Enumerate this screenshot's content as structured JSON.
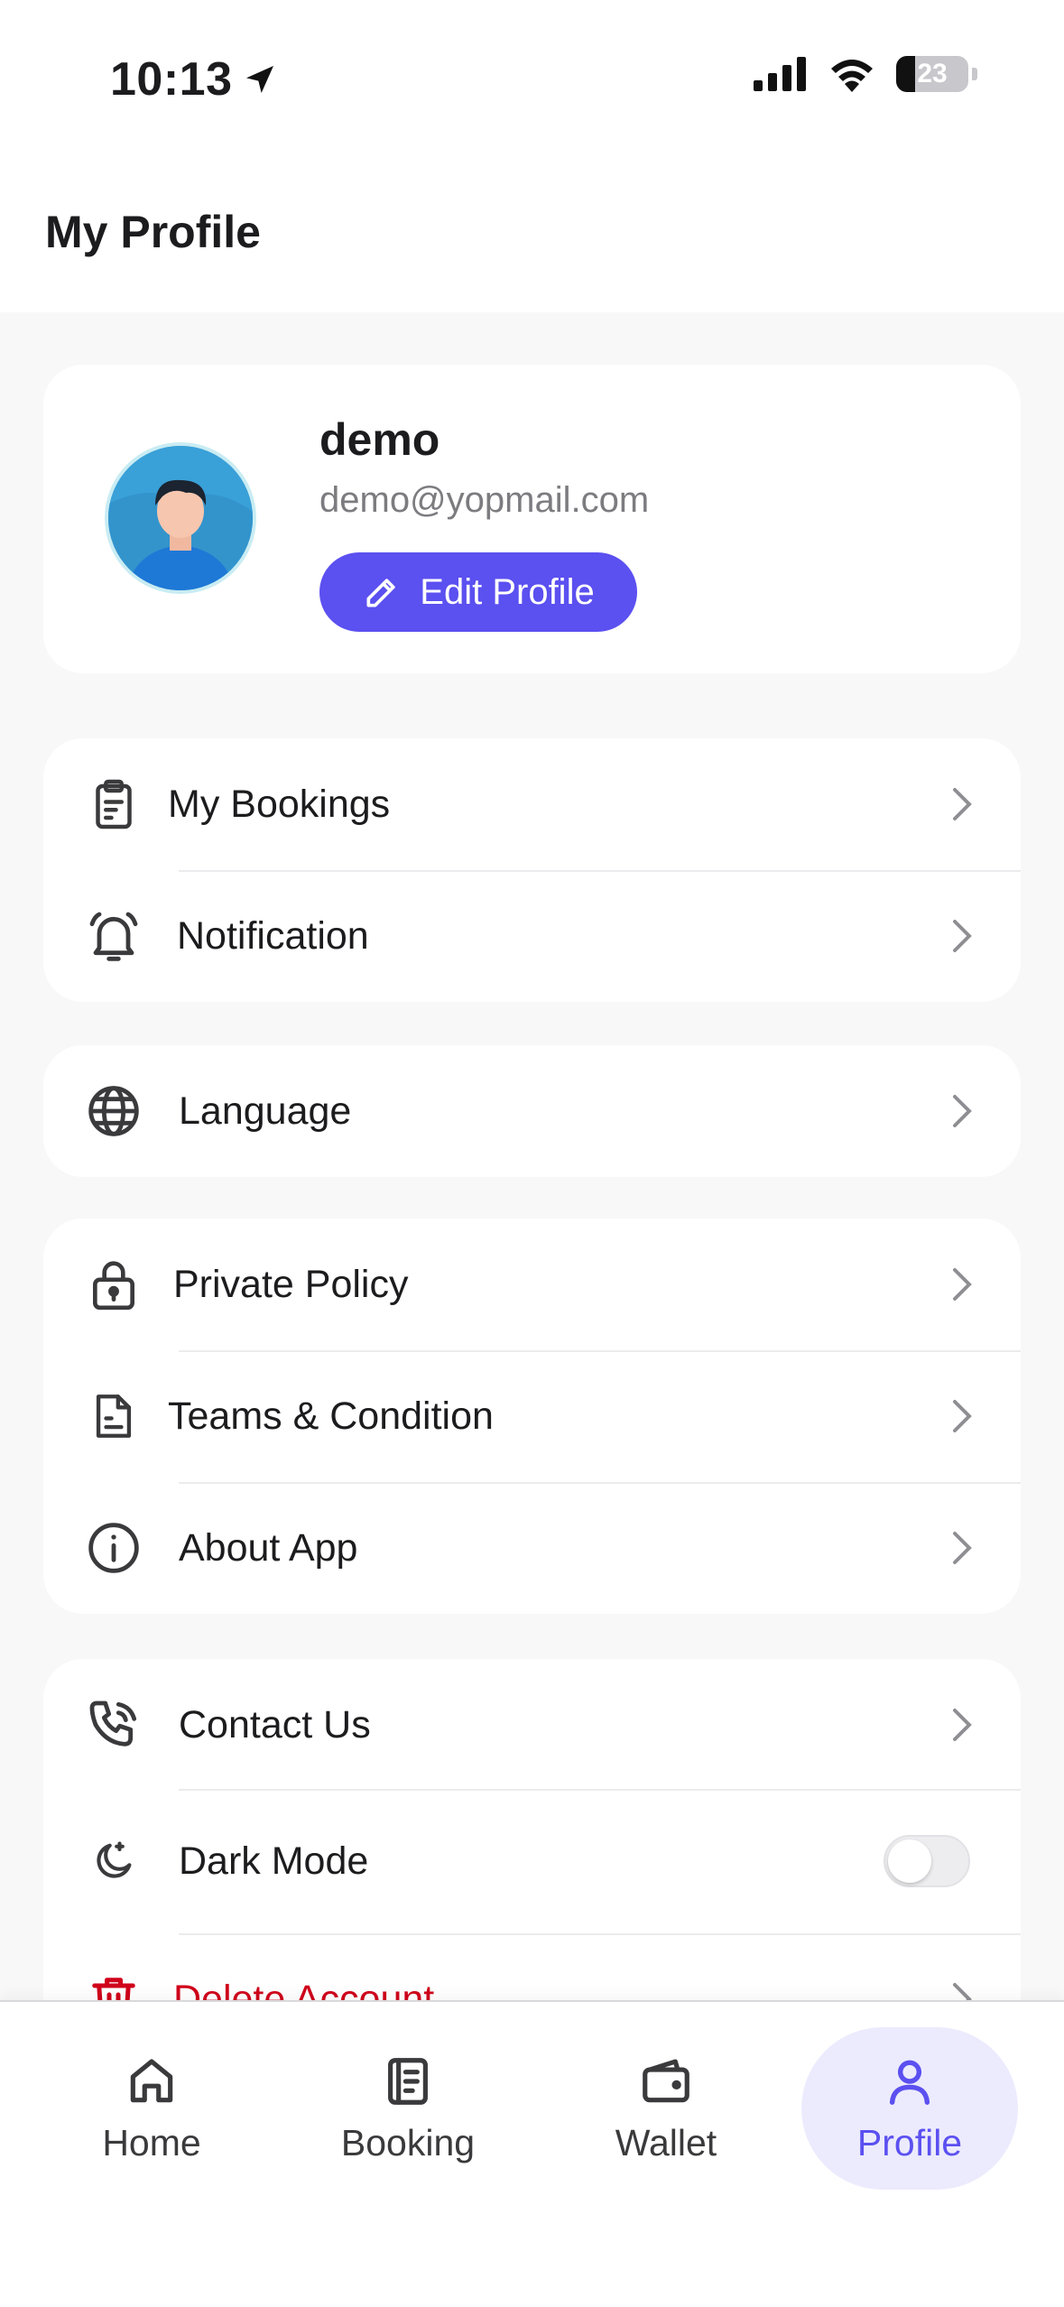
{
  "status_bar": {
    "time": "10:13",
    "battery": "23"
  },
  "header": {
    "title": "My Profile"
  },
  "profile": {
    "name": "demo",
    "email": "demo@yopmail.com",
    "edit_label": "Edit Profile"
  },
  "menu": {
    "my_bookings": "My Bookings",
    "notification": "Notification",
    "language": "Language",
    "private_policy": "Private Policy",
    "teams_condition": "Teams & Condition",
    "about_app": "About App",
    "contact_us": "Contact Us",
    "dark_mode": "Dark Mode",
    "dark_mode_on": false,
    "delete_account": "Delete Account"
  },
  "bottom_nav": {
    "home": "Home",
    "booking": "Booking",
    "wallet": "Wallet",
    "profile": "Profile",
    "active": "profile"
  },
  "colors": {
    "accent": "#5b50f0",
    "danger": "#d0021b",
    "active_bg": "#ecebfd"
  }
}
